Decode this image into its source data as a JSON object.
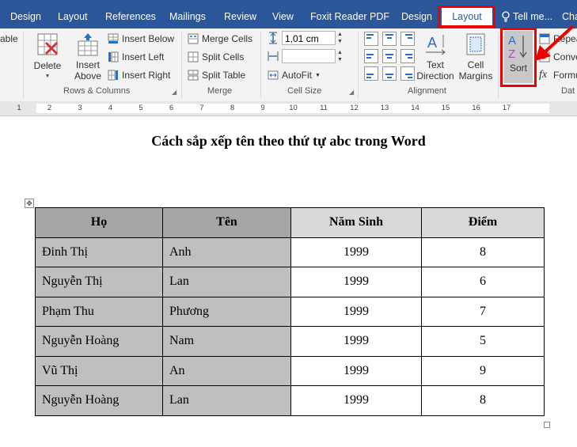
{
  "tabs": [
    "Design",
    "Layout",
    "References",
    "Mailings",
    "Review",
    "View",
    "Foxit Reader PDF",
    "Design",
    "Layout"
  ],
  "tell_me": "Tell me...",
  "tab_overflow": "Cha",
  "ribbon": {
    "table_clip": "able",
    "delete_label": "Delete",
    "insert_above_label_1": "Insert",
    "insert_above_label_2": "Above",
    "insert_below": "Insert Below",
    "insert_left": "Insert Left",
    "insert_right": "Insert Right",
    "rows_columns": "Rows & Columns",
    "merge_cells": "Merge Cells",
    "split_cells": "Split Cells",
    "split_table": "Split Table",
    "merge": "Merge",
    "height_value": "1,01 cm",
    "width_value": "",
    "autofit": "AutoFit",
    "cell_size": "Cell Size",
    "text_direction_1": "Text",
    "text_direction_2": "Direction",
    "cell_margins_1": "Cell",
    "cell_margins_2": "Margins",
    "alignment": "Alignment",
    "sort": "Sort",
    "repeat_clip": "Repea",
    "convert_clip": "Conve",
    "formula_clip": "Formu",
    "data_clip": "Dat"
  },
  "ruler_numbers": [
    "1",
    "2",
    "3",
    "4",
    "5",
    "6",
    "7",
    "8",
    "9",
    "10",
    "11",
    "12",
    "13",
    "14",
    "15",
    "16",
    "17"
  ],
  "document": {
    "title": "Cách sắp xếp tên theo thứ tự abc trong Word",
    "headers": [
      "Họ",
      "Tên",
      "Năm Sinh",
      "Điểm"
    ],
    "rows": [
      [
        "Đinh Thị",
        "Anh",
        "1999",
        "8"
      ],
      [
        "Nguyễn Thị",
        "Lan",
        "1999",
        "6"
      ],
      [
        "Phạm Thu",
        "Phương",
        "1999",
        "7"
      ],
      [
        "Nguyễn Hoàng",
        "Nam",
        "1999",
        "5"
      ],
      [
        "Vũ Thị",
        "An",
        "1999",
        "9"
      ],
      [
        "Nguyễn Hoàng",
        "Lan",
        "1999",
        "8"
      ]
    ]
  },
  "colors": {
    "tab_bar": "#2b579a",
    "highlight_dark": "#a6a6a6",
    "highlight_mid": "#bfbfbf",
    "header_light": "#d9d9d9",
    "annotation": "#e00000"
  }
}
